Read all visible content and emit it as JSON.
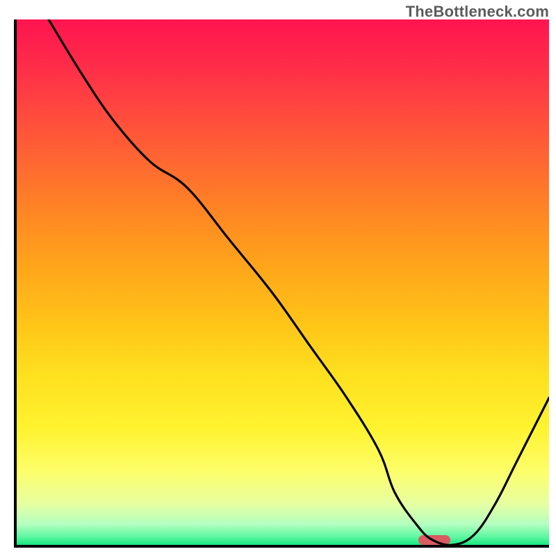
{
  "watermark": "TheBottleneck.com",
  "colors": {
    "gradient_top": "#ff1450",
    "gradient_bottom": "#17e87f",
    "curve": "#000000",
    "marker": "#da5a62",
    "axes": "#000000"
  },
  "chart_data": {
    "type": "line",
    "title": "",
    "xlabel": "",
    "ylabel": "",
    "xlim": [
      0,
      100
    ],
    "ylim": [
      0,
      100
    ],
    "grid": false,
    "notes": "Vertical gradient from red (top, worst fit) to green (bottom, best fit). Curve shows bottleneck error vs x; minimum near right side. Small rounded marker on baseline indicates optimal x.",
    "series": [
      {
        "name": "bottleneck-curve",
        "x": [
          6,
          12,
          18,
          25,
          32,
          40,
          48,
          55,
          62,
          68,
          71,
          75,
          78,
          82,
          86,
          90,
          94,
          100
        ],
        "y": [
          100,
          90,
          81,
          73,
          68,
          58,
          48,
          38,
          28,
          18,
          10,
          4,
          1,
          0,
          2,
          8,
          16,
          28
        ]
      }
    ],
    "marker": {
      "x": 78,
      "width_fraction": 0.06
    }
  }
}
